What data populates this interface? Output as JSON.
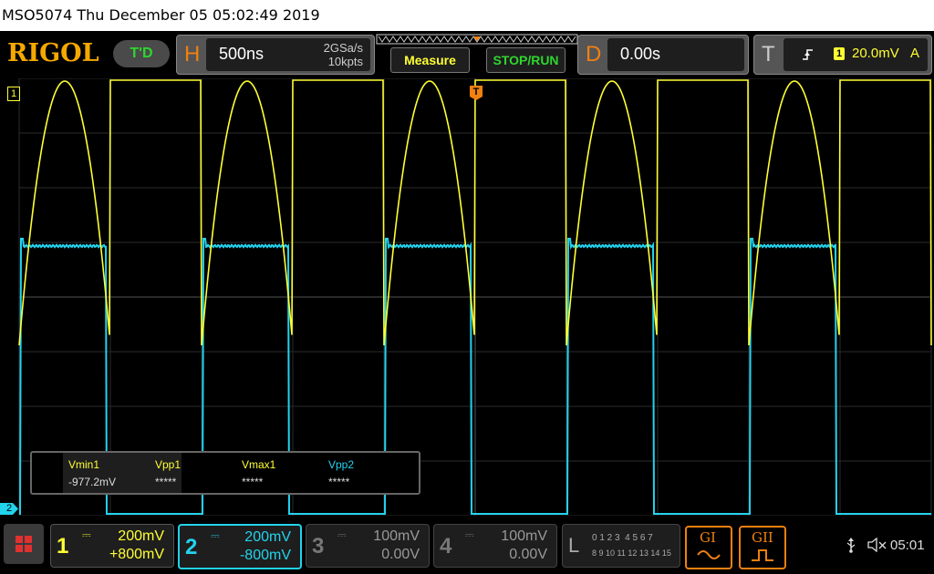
{
  "title_bar": {
    "text": "MSO5074  Thu December 05 05:02:49 2019"
  },
  "toolbar": {
    "logo": "RIGOL",
    "mode_badge": "T'D",
    "horizontal": {
      "letter": "H",
      "timebase": "500ns",
      "sample_rate": "2GSa/s",
      "memory_depth": "10kpts"
    },
    "measure_label": "Measure",
    "stop_run_label": "STOP/RUN",
    "delay": {
      "letter": "D",
      "value": "0.00s"
    },
    "trigger": {
      "letter": "T",
      "source": "1",
      "level": "20.0mV",
      "mode": "A"
    }
  },
  "screen": {
    "ch1_marker": "1",
    "ch2_marker": "2",
    "trigger_marker": "T"
  },
  "measurements": [
    {
      "label": "Vmin1",
      "value": "-977.2mV",
      "color": "#ffff33"
    },
    {
      "label": "Vpp1",
      "value": "*****",
      "color": "#ffff33"
    },
    {
      "label": "Vmax1",
      "value": "*****",
      "color": "#ffff33"
    },
    {
      "label": "Vpp2",
      "value": "*****",
      "color": "#22d3ee"
    }
  ],
  "channels": [
    {
      "num": "1",
      "scale": "200mV",
      "offset": "+800mV",
      "color": "#ffff33",
      "active": true
    },
    {
      "num": "2",
      "scale": "200mV",
      "offset": "-800mV",
      "color": "#22d3ee",
      "active": true
    },
    {
      "num": "3",
      "scale": "100mV",
      "offset": "0.00V",
      "color": "#888888",
      "active": false
    },
    {
      "num": "4",
      "scale": "100mV",
      "offset": "0.00V",
      "color": "#888888",
      "active": false
    }
  ],
  "logic": {
    "letter": "L",
    "row1": "0 1 2 3  4 5 6 7",
    "row2": "8 9 10 11 12 13 14 15"
  },
  "generators": {
    "g1": "GI",
    "g2": "GII"
  },
  "status": {
    "time": "05:01"
  },
  "colors": {
    "ch1": "#ffff33",
    "ch2": "#22d3ee",
    "accent": "#f08010",
    "green": "#2ed62e"
  }
}
